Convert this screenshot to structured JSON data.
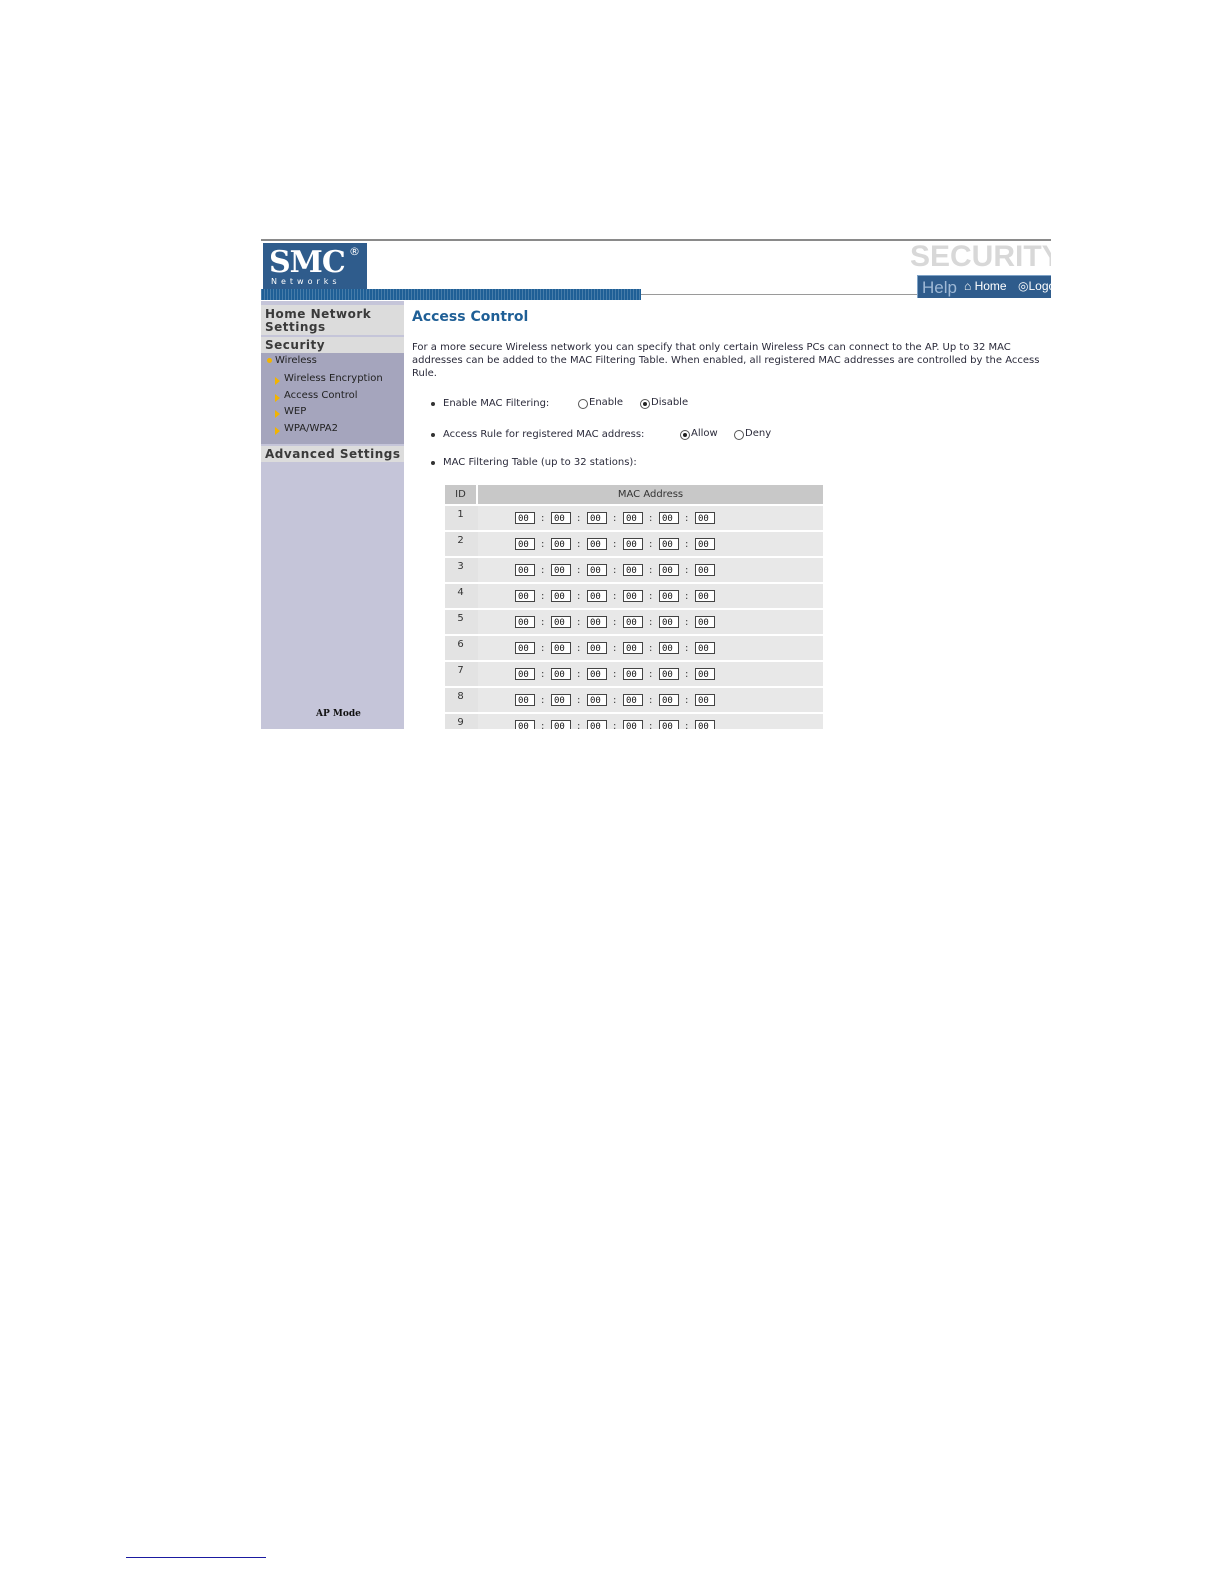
{
  "header": {
    "logo_name": "SMC",
    "logo_reg": "®",
    "logo_sub": "Networks",
    "section_watermark": "SECURITY",
    "topnav": {
      "help": "Help",
      "home": "Home",
      "logout": "Logo"
    }
  },
  "sidebar": {
    "home_network": "Home Network Settings",
    "security": "Security",
    "wireless": "Wireless",
    "items": [
      "Wireless Encryption",
      "Access Control",
      "WEP",
      "WPA/WPA2"
    ],
    "advanced": "Advanced Settings",
    "mode": "AP Mode"
  },
  "main": {
    "title": "Access Control",
    "intro": "For a more secure Wireless network you can specify that only certain Wireless PCs can connect to the AP. Up to 32 MAC addresses can be added to the MAC Filtering Table. When enabled, all registered MAC addresses are controlled by the Access Rule.",
    "mac_filtering": {
      "label": "Enable MAC Filtering:",
      "options": [
        "Enable",
        "Disable"
      ],
      "selected": "Disable"
    },
    "access_rule": {
      "label": "Access Rule for registered MAC address:",
      "options": [
        "Allow",
        "Deny"
      ],
      "selected": "Allow"
    },
    "table_label": "MAC Filtering Table (up to 32 stations):",
    "table": {
      "headers": [
        "ID",
        "MAC Address"
      ],
      "rows": [
        {
          "id": "1",
          "octets": [
            "00",
            "00",
            "00",
            "00",
            "00",
            "00"
          ]
        },
        {
          "id": "2",
          "octets": [
            "00",
            "00",
            "00",
            "00",
            "00",
            "00"
          ]
        },
        {
          "id": "3",
          "octets": [
            "00",
            "00",
            "00",
            "00",
            "00",
            "00"
          ]
        },
        {
          "id": "4",
          "octets": [
            "00",
            "00",
            "00",
            "00",
            "00",
            "00"
          ]
        },
        {
          "id": "5",
          "octets": [
            "00",
            "00",
            "00",
            "00",
            "00",
            "00"
          ]
        },
        {
          "id": "6",
          "octets": [
            "00",
            "00",
            "00",
            "00",
            "00",
            "00"
          ]
        },
        {
          "id": "7",
          "octets": [
            "00",
            "00",
            "00",
            "00",
            "00",
            "00"
          ]
        },
        {
          "id": "8",
          "octets": [
            "00",
            "00",
            "00",
            "00",
            "00",
            "00"
          ]
        },
        {
          "id": "9",
          "octets": [
            "00",
            "00",
            "00",
            "00",
            "00",
            "00"
          ]
        }
      ]
    }
  }
}
